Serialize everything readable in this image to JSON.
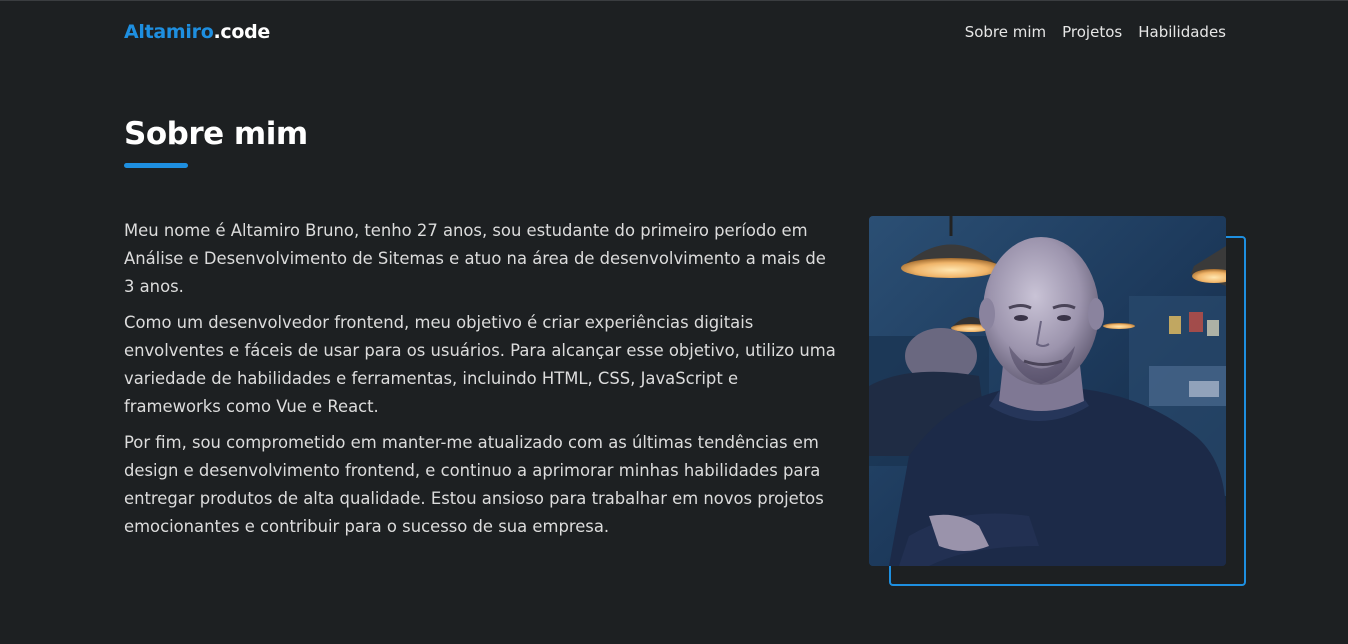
{
  "header": {
    "logo_part1": "Altamiro",
    "logo_part2": ".code",
    "nav": [
      "Sobre mim",
      "Projetos",
      "Habilidades"
    ]
  },
  "about": {
    "title": "Sobre mim",
    "paragraphs": [
      "Meu nome é Altamiro Bruno, tenho 27 anos, sou estudante do primeiro período em Análise e Desenvolvimento de Sitemas e atuo na área de desenvolvimento a mais de 3 anos.",
      "Como um desenvolvedor frontend, meu objetivo é criar experiências digitais envolventes e fáceis de usar para os usuários. Para alcançar esse objetivo, utilizo uma variedade de habilidades e ferramentas, incluindo HTML, CSS, JavaScript e frameworks como Vue e React.",
      "Por fim, sou comprometido em manter-me atualizado com as últimas tendências em design e desenvolvimento frontend, e continuo a aprimorar minhas habilidades para entregar produtos de alta qualidade. Estou ansioso para trabalhar em novos projetos emocionantes e contribuir para o sucesso de sua empresa."
    ]
  },
  "colors": {
    "background": "#1d2022",
    "accent": "#1e8fe0",
    "text": "#dcdcdc",
    "heading": "#ffffff"
  }
}
